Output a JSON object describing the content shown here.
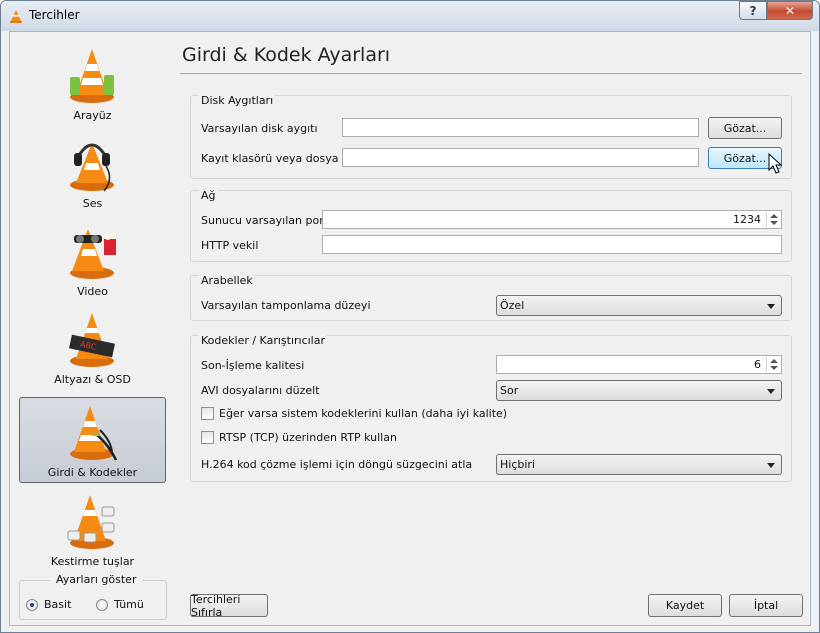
{
  "window": {
    "title": "Tercihler",
    "help_label": "?",
    "close_label": "✕"
  },
  "sidebar": {
    "items": [
      {
        "label": "Arayüz",
        "icon": "vlc-cone-interface-icon"
      },
      {
        "label": "Ses",
        "icon": "vlc-cone-headphones-icon"
      },
      {
        "label": "Video",
        "icon": "vlc-cone-video-icon"
      },
      {
        "label": "Altyazı & OSD",
        "icon": "vlc-cone-subtitles-icon"
      },
      {
        "label": "Girdi & Kodekler",
        "icon": "vlc-cone-input-codecs-icon",
        "selected": true
      },
      {
        "label": "Kestirme tuşlar",
        "icon": "vlc-cone-hotkeys-icon"
      }
    ]
  },
  "show_settings": {
    "title": "Ayarları göster",
    "basic": "Basit",
    "all": "Tümü",
    "selected": "Basit"
  },
  "page": {
    "title": "Girdi & Kodek Ayarları"
  },
  "disk": {
    "title": "Disk Aygıtları",
    "default_device_label": "Varsayılan disk aygıtı",
    "default_device_value": "",
    "record_label": "Kayıt klasörü veya dosya adı",
    "record_value": "",
    "browse_label": "Gözat...",
    "browse2_label": "Gözat..."
  },
  "network": {
    "title": "Ağ",
    "port_label": "Sunucu varsayılan portu",
    "port_value": "1234",
    "proxy_label": "HTTP vekil",
    "proxy_value": ""
  },
  "cache": {
    "title": "Arabellek",
    "level_label": "Varsayılan tamponlama düzeyi",
    "level_value": "Özel"
  },
  "codecs": {
    "title": "Kodekler / Karıştırıcılar",
    "pp_label": "Son-İşleme kalitesi",
    "pp_value": "6",
    "avi_label": "AVI dosyalarını düzelt",
    "avi_value": "Sor",
    "sys_codecs_label": "Eğer varsa sistem kodeklerini kullan (daha iyi kalite)",
    "sys_codecs_checked": false,
    "rtsp_label": "RTSP (TCP) üzerinden RTP kullan",
    "rtsp_checked": false,
    "h264_label": "H.264 kod çözme işlemi için döngü süzgecini atla",
    "h264_value": "Hiçbiri"
  },
  "footer": {
    "reset_label": "Tercihleri Sıfırla",
    "save_label": "Kaydet",
    "cancel_label": "İptal"
  }
}
